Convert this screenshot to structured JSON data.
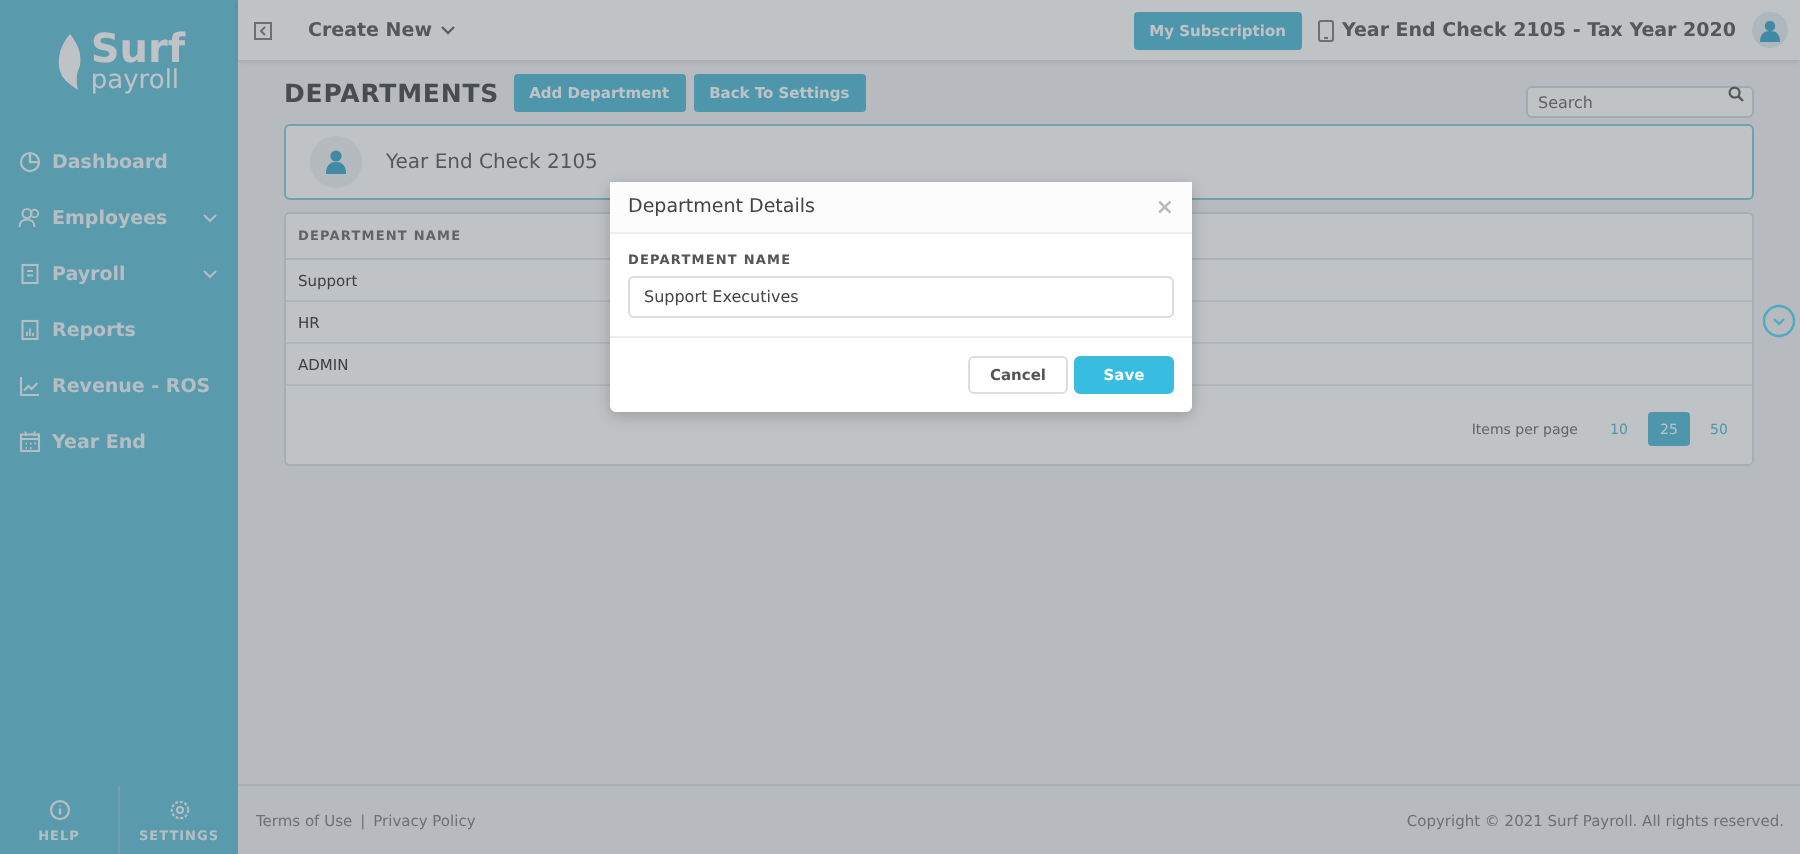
{
  "sidebar": {
    "logo": {
      "word": "Surf",
      "sub": "payroll"
    },
    "items": [
      {
        "label": "Dashboard",
        "kind": "link"
      },
      {
        "label": "Employees",
        "kind": "group"
      },
      {
        "label": "Payroll",
        "kind": "group"
      },
      {
        "label": "Reports",
        "kind": "link"
      },
      {
        "label": "Revenue - ROS",
        "kind": "link"
      },
      {
        "label": "Year End",
        "kind": "link"
      }
    ],
    "bottom": [
      "HELP",
      "SETTINGS"
    ]
  },
  "topbar": {
    "create": "Create New",
    "subscription": "My Subscription",
    "company": "Year End Check 2105 - Tax Year 2020"
  },
  "page": {
    "title": "DEPARTMENTS",
    "buttons": [
      "Add Department",
      "Back To Settings"
    ],
    "search": {
      "placeholder": "Search"
    },
    "company_card": "Year End Check 2105"
  },
  "table": {
    "columns": [
      "DEPARTMENT NAME"
    ],
    "rows": [
      "Support",
      "HR",
      "ADMIN"
    ],
    "pager": {
      "label": "Items per page",
      "options": [
        {
          "label": "10",
          "selected": false
        },
        {
          "label": "25",
          "selected": true
        },
        {
          "label": "50",
          "selected": false
        }
      ]
    }
  },
  "footer": {
    "links": [
      "Terms of Use",
      "Privacy Policy"
    ],
    "separator": "|",
    "copyright": "Copyright © 2021 Surf Payroll. All rights reserved."
  },
  "modal": {
    "title": "Department Details",
    "close": "×",
    "field_label": "DEPARTMENT NAME",
    "field_value": "Support Executives",
    "buttons": [
      {
        "label": "Cancel",
        "kind": "secondary"
      },
      {
        "label": "Save",
        "kind": "primary"
      }
    ]
  }
}
